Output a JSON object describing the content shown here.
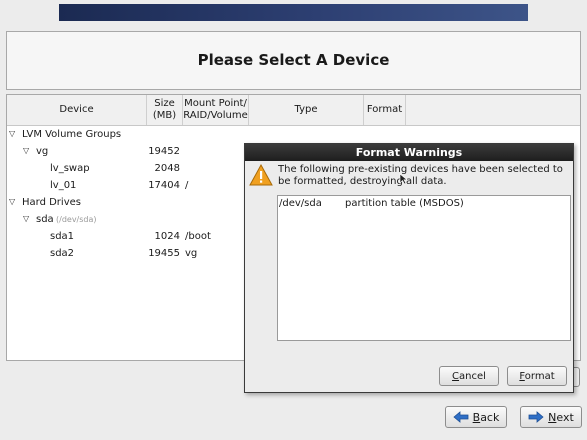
{
  "header": {
    "title": "Please Select A Device"
  },
  "columns": {
    "device": "Device",
    "size_l1": "Size",
    "size_l2": "(MB)",
    "mount_l1": "Mount Point/",
    "mount_l2": "RAID/Volume",
    "type": "Type",
    "format": "Format"
  },
  "tree": {
    "lvm_group": "LVM Volume Groups",
    "vg": {
      "name": "vg",
      "size": "19452"
    },
    "lv_swap": {
      "name": "lv_swap",
      "size": "2048",
      "mount": ""
    },
    "lv_01": {
      "name": "lv_01",
      "size": "17404",
      "mount": "/"
    },
    "hard_drives": "Hard Drives",
    "sda": {
      "name": "sda",
      "path": "(/dev/sda)"
    },
    "sda1": {
      "name": "sda1",
      "size": "1024",
      "mount": "/boot"
    },
    "sda2": {
      "name": "sda2",
      "size": "19455",
      "mount": "vg"
    }
  },
  "dialog": {
    "title": "Format Warnings",
    "message": "The following pre-existing devices have been selected to be formatted, destroying all data.",
    "items": [
      {
        "device": "/dev/sda",
        "description": "partition table (MSDOS)"
      }
    ],
    "cancel_label": "Cancel",
    "format_label": "Format"
  },
  "nav": {
    "back_label": "Back",
    "next_label": "Next"
  },
  "colors": {
    "banner": "#2d3f72",
    "arrow_blue": "#2f6fc6",
    "warning": "#f0a020"
  }
}
